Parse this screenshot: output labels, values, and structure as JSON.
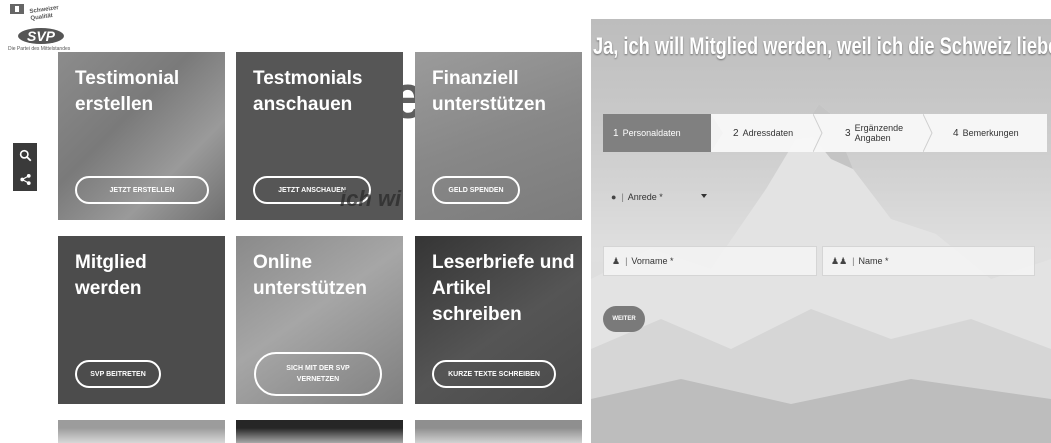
{
  "logo": {
    "slogan": "Schweizer Qualität",
    "badge": "SVP",
    "tagline": "Die Partei des Mittelstandes"
  },
  "side_tools": [
    {
      "icon": "search-icon"
    },
    {
      "icon": "share-icon"
    }
  ],
  "hero": {
    "word": "Fre",
    "sub": "ich wi"
  },
  "tiles": [
    {
      "title": "Testimonial\nerstellen",
      "cta": "JETZT ERSTELLEN"
    },
    {
      "title": "Testmonials\nanschauen",
      "cta": "JETZT ANSCHAUEN"
    },
    {
      "title": "Finanziell\nunterstützen",
      "cta": "GELD SPENDEN"
    },
    {
      "title": "Mitglied\nwerden",
      "cta": "SVP BEITRETEN"
    },
    {
      "title": "Online\nunterstützen",
      "cta": "SICH MIT DER SVP\nVERNETZEN"
    },
    {
      "title": "Leserbriefe und\nArtikel\nschreiben",
      "cta": "KURZE TEXTE SCHREIBEN"
    }
  ],
  "form": {
    "title": "Ja, ich will Mitglied werden, weil ich die Schweiz liebe!",
    "steps": [
      {
        "num": "1",
        "label": "Personaldaten",
        "active": true
      },
      {
        "num": "2",
        "label": "Adressdaten",
        "active": false
      },
      {
        "num": "3",
        "label": "Ergänzende Angaben",
        "active": false
      },
      {
        "num": "4",
        "label": "Bemerkungen",
        "active": false
      }
    ],
    "anrede_placeholder": "Anrede *",
    "vorname_placeholder": "Vorname *",
    "name_placeholder": "Name *",
    "next_button": "WEITER"
  },
  "colors": {
    "tile_dark": "#4c4c4c",
    "active_step": "#808080",
    "button": "#7a7a7a"
  }
}
